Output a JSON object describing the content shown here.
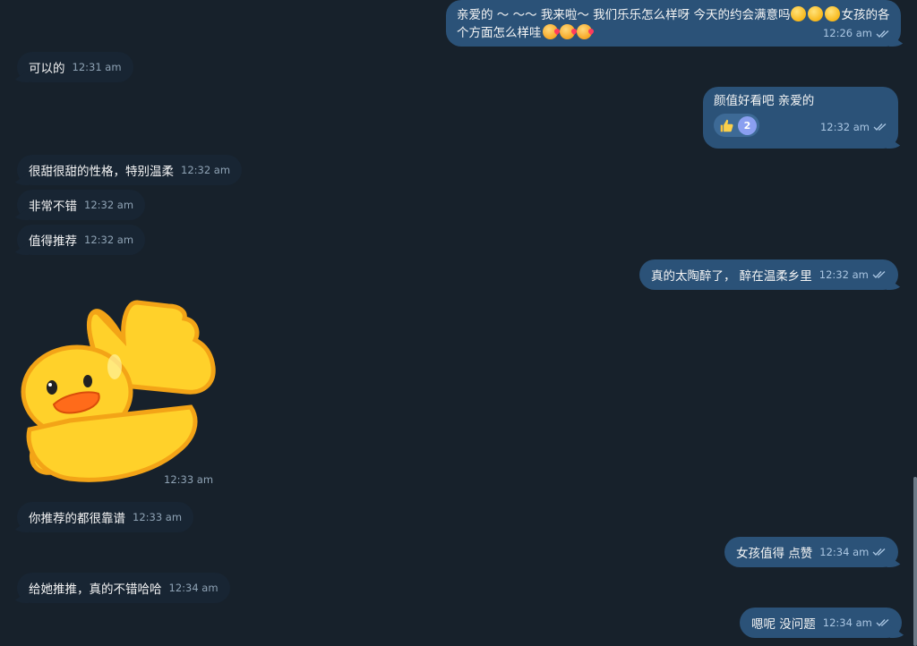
{
  "messages": [
    {
      "id": "m1",
      "side": "out",
      "text_before": "亲爱的 ～ ～～ 我来啦～ 我们乐乐怎么样呀 今天的约会满意吗",
      "text_after": "女孩的各个方面怎么样哇",
      "time": "12:26 am",
      "emoji_before": [
        "star-struck-emoji",
        "star-struck-emoji",
        "star-struck-emoji"
      ],
      "emoji_after": [
        "kissing-heart-emoji",
        "kissing-heart-emoji",
        "kissing-heart-emoji"
      ]
    },
    {
      "id": "m2",
      "side": "in",
      "text": "可以的",
      "time": "12:31 am"
    },
    {
      "id": "m3",
      "side": "out",
      "text": "颜值好看吧 亲爱的",
      "time": "12:32 am",
      "reaction": {
        "icon": "thumbs-up-icon",
        "count": "2"
      }
    },
    {
      "id": "m4",
      "side": "in",
      "text": "很甜很甜的性格，特别温柔",
      "time": "12:32 am"
    },
    {
      "id": "m5",
      "side": "in",
      "text": "非常不错",
      "time": "12:32 am"
    },
    {
      "id": "m6",
      "side": "in",
      "text": "值得推荐",
      "time": "12:32 am"
    },
    {
      "id": "m7",
      "side": "out",
      "text": "真的太陶醉了， 醉在温柔乡里",
      "time": "12:32 am"
    },
    {
      "id": "m8",
      "side": "in",
      "sticker": "duck-thumbs-up-sticker",
      "time": "12:33 am"
    },
    {
      "id": "m9",
      "side": "in",
      "text": "你推荐的都很靠谱",
      "time": "12:33 am"
    },
    {
      "id": "m10",
      "side": "out",
      "text": "女孩值得 点赞",
      "time": "12:34 am"
    },
    {
      "id": "m11",
      "side": "in",
      "text": "给她推推，真的不错哈哈",
      "time": "12:34 am"
    },
    {
      "id": "m12",
      "side": "out",
      "text": "嗯呢 没问题",
      "time": "12:34 am"
    }
  ],
  "colors": {
    "background": "#17212b",
    "incoming_bubble": "#182533",
    "outgoing_bubble": "#2b5278",
    "time_text": "#8fa3b5"
  }
}
